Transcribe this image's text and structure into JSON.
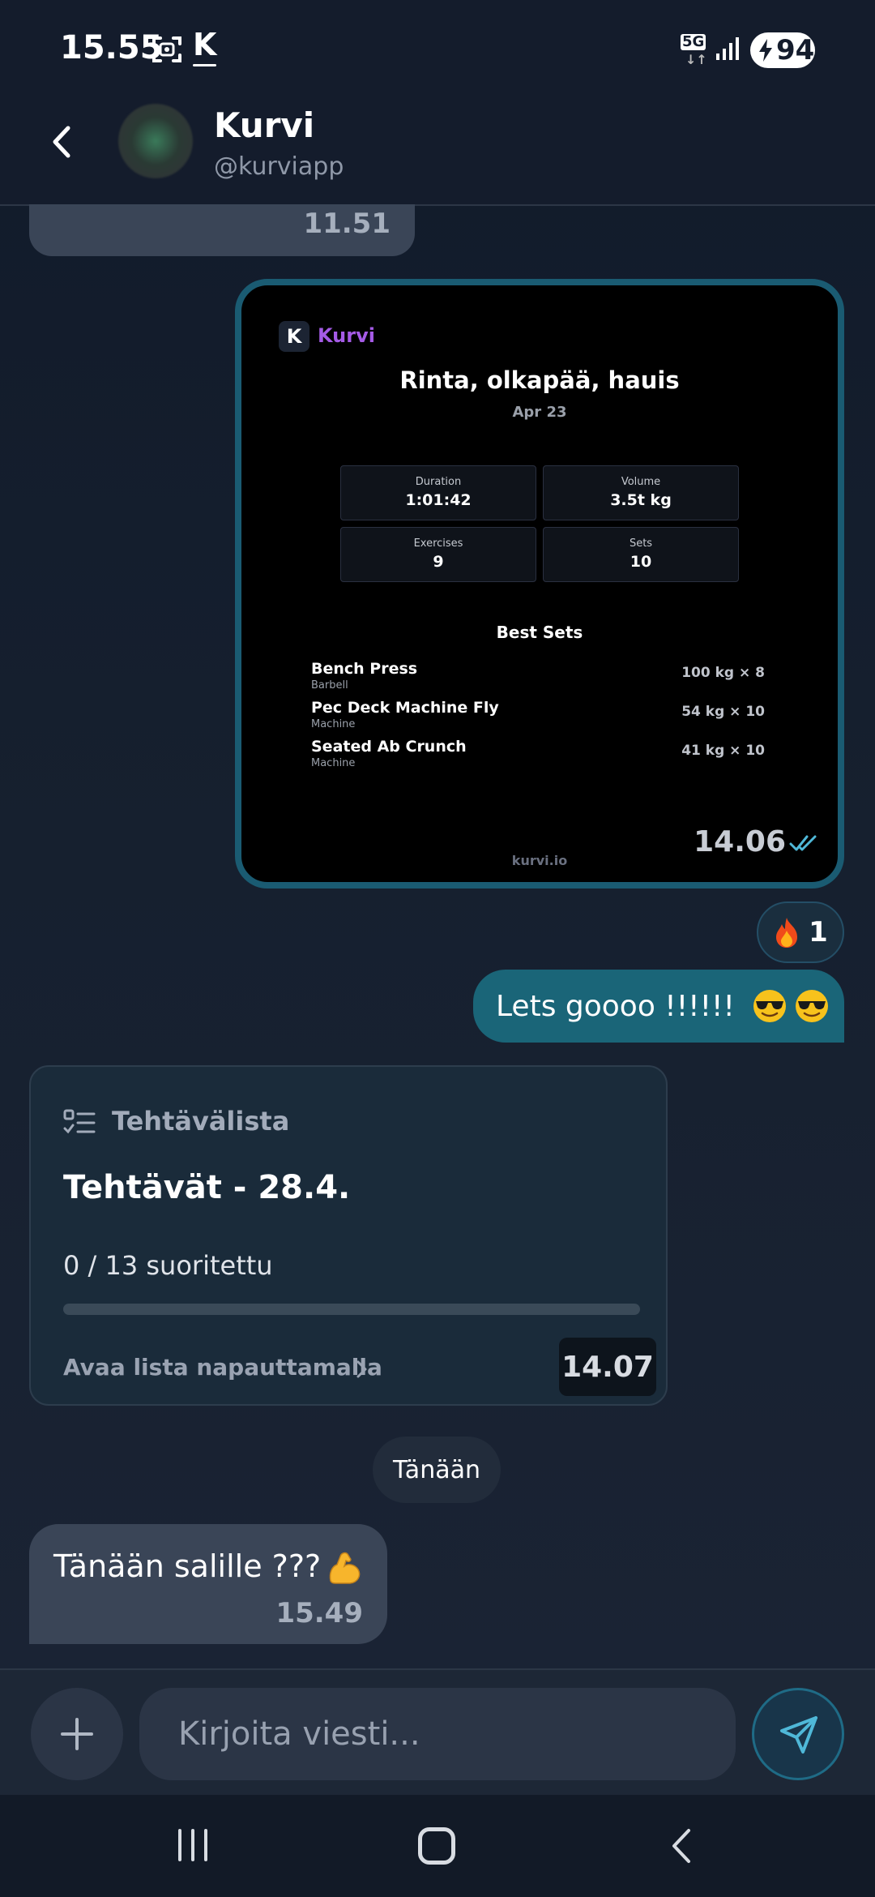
{
  "status_bar": {
    "time": "15.55",
    "app_glyph": "K",
    "network": "5G",
    "network_arrows": "↓↑",
    "battery": "94"
  },
  "header": {
    "name": "Kurvi",
    "handle": "@kurviapp"
  },
  "messages": {
    "prev_time": "11.51",
    "workout": {
      "brand": "Kurvi",
      "logo_letter": "K",
      "title": "Rinta, olkapää, hauis",
      "date": "Apr 23",
      "stats": [
        {
          "label": "Duration",
          "value": "1:01:42"
        },
        {
          "label": "Volume",
          "value": "3.5t kg"
        },
        {
          "label": "Exercises",
          "value": "9"
        },
        {
          "label": "Sets",
          "value": "10"
        }
      ],
      "best_sets_title": "Best Sets",
      "best_sets": [
        {
          "name": "Bench Press",
          "equipment": "Barbell",
          "value": "100 kg × 8"
        },
        {
          "name": "Pec Deck Machine Fly",
          "equipment": "Machine",
          "value": "54 kg × 10"
        },
        {
          "name": "Seated Ab Crunch",
          "equipment": "Machine",
          "value": "41 kg × 10"
        }
      ],
      "url": "kurvi.io",
      "time": "14.06"
    },
    "reaction": {
      "emoji": "fire-icon",
      "count": "1"
    },
    "outgoing_text": "Lets goooo !!!!!!",
    "outgoing_emoji": [
      "smiling-face-with-sunglasses-icon",
      "smiling-face-with-sunglasses-icon"
    ],
    "task_card": {
      "kind": "Tehtävälista",
      "title": "Tehtävät - 28.4.",
      "progress_text": "0 / 13 suoritettu",
      "progress_fraction": 0,
      "open_label": "Avaa lista napauttamalla",
      "time": "14.07"
    },
    "date_separator": "Tänään",
    "incoming": {
      "text": "Tänään salille ???",
      "emoji": "flexed-biceps-icon",
      "time": "15.49"
    }
  },
  "composer": {
    "placeholder": "Kirjoita viesti..."
  },
  "colors": {
    "accent": "#1a6578",
    "brand_purple": "#a55be6",
    "check": "#4fb8d8"
  }
}
